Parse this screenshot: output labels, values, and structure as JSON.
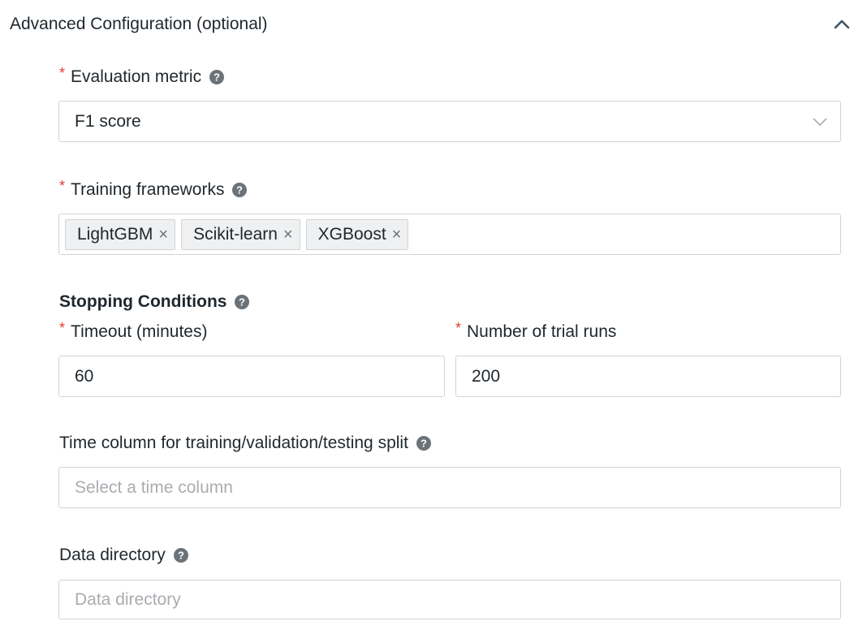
{
  "section": {
    "title": "Advanced Configuration (optional)",
    "collapse_icon": "chevron-up-icon"
  },
  "evaluation_metric": {
    "label": "Evaluation metric",
    "required_mark": "*",
    "value": "F1 score"
  },
  "training_frameworks": {
    "label": "Training frameworks",
    "required_mark": "*",
    "tags": [
      "LightGBM",
      "Scikit-learn",
      "XGBoost"
    ],
    "remove_glyph": "×"
  },
  "stopping_conditions": {
    "title": "Stopping Conditions",
    "timeout": {
      "label": "Timeout (minutes)",
      "required_mark": "*",
      "value": "60"
    },
    "trial_runs": {
      "label": "Number of trial runs",
      "required_mark": "*",
      "value": "200"
    }
  },
  "time_column": {
    "label": "Time column for training/validation/testing split",
    "placeholder": "Select a time column"
  },
  "data_directory": {
    "label": "Data directory",
    "placeholder": "Data directory"
  },
  "colors": {
    "required": "#e53935",
    "border": "#cfd4d8",
    "text": "#1f272d",
    "placeholder": "#a9adb1",
    "help_icon": "#6b7278"
  }
}
